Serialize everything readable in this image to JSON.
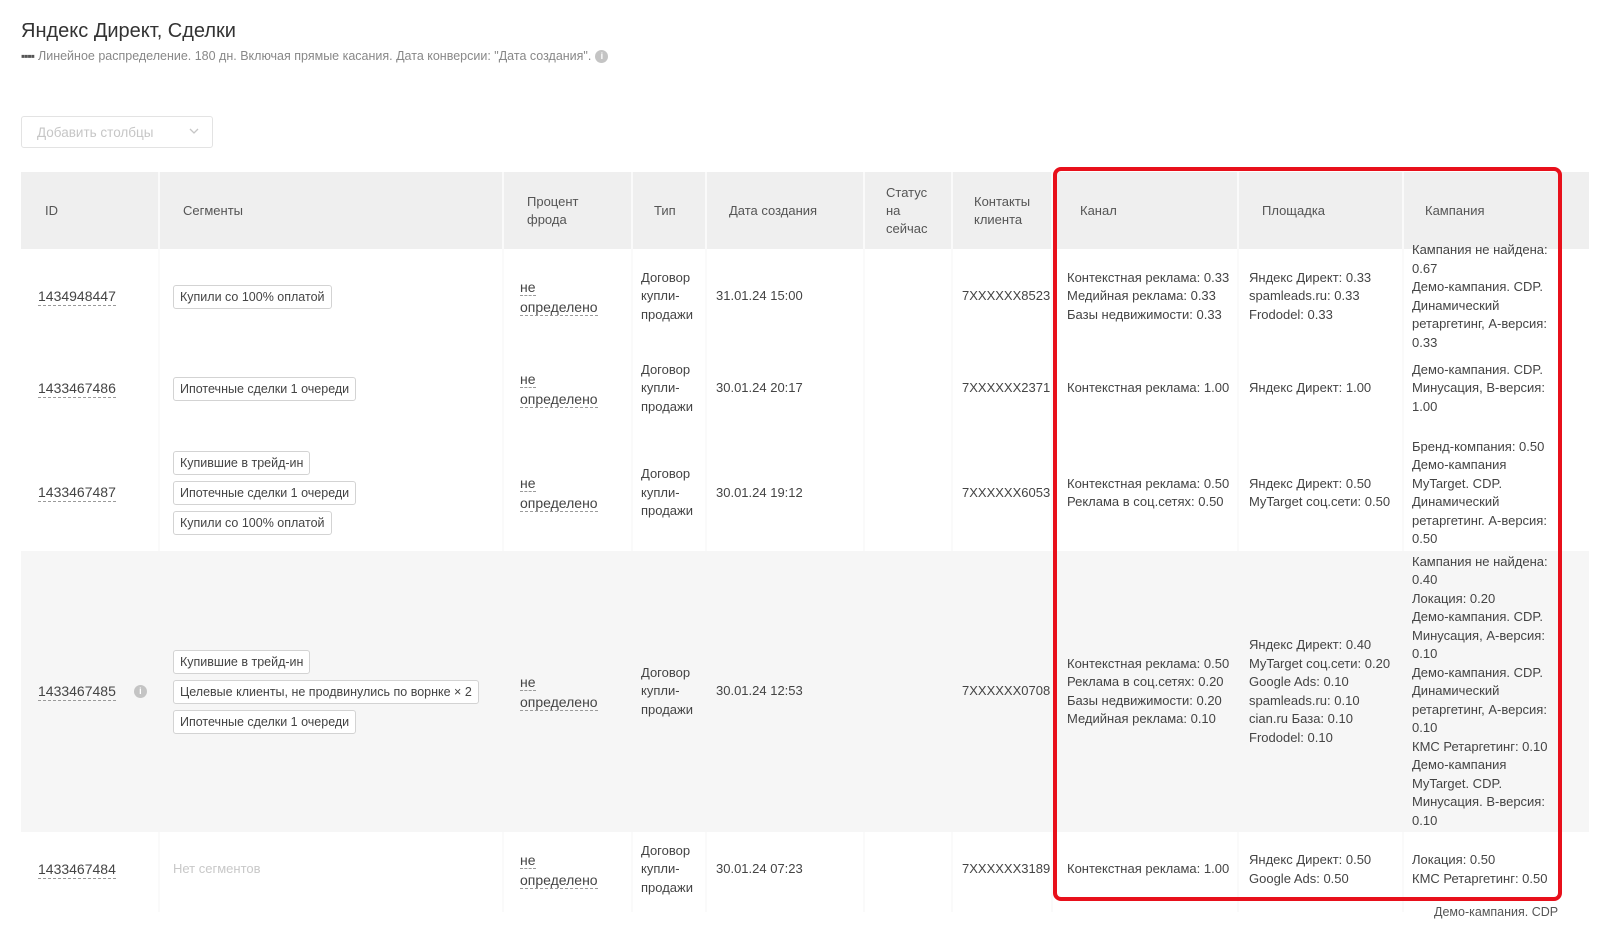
{
  "header": {
    "title": "Яндекс Директ, Сделки",
    "subtitle": "Линейное распределение. 180 дн. Включая прямые касания. Дата конверсии: \"Дата создания\".",
    "dots": "▪▪▪▪"
  },
  "toolbar": {
    "add_columns_placeholder": "Добавить столбцы"
  },
  "columns": {
    "id": "ID",
    "segments": "Сегменты",
    "fraud": "Процент фрода",
    "type": "Тип",
    "created": "Дата создания",
    "status": "Статус на сейчас",
    "contacts": "Контакты клиента",
    "channel": "Канал",
    "platform": "Площадка",
    "campaign": "Кампания"
  },
  "rows": [
    {
      "id": "1434948447",
      "segments": [
        "Купили со 100% оплатой"
      ],
      "fraud": "не определено",
      "type": "Договор купли-продажи",
      "created": "31.01.24 15:00",
      "status": "",
      "contact": "7XXXXXX8523",
      "channel": [
        "Контекстная реклама: 0.33",
        "Медийная реклама: 0.33",
        "Базы недвижимости: 0.33"
      ],
      "platform": [
        "Яндекс Директ: 0.33",
        "spamleads.ru: 0.33",
        "Frododel: 0.33"
      ],
      "campaign": [
        "Кампания не найдена: 0.67",
        "Демо-кампания. CDP. Динамический ретаргетинг, А-версия: 0.33"
      ]
    },
    {
      "id": "1433467486",
      "segments": [
        "Ипотечные сделки 1 очереди"
      ],
      "fraud": "не определено",
      "type": "Договор купли-продажи",
      "created": "30.01.24 20:17",
      "status": "",
      "contact": "7XXXXXX2371",
      "channel": [
        "Контекстная реклама: 1.00"
      ],
      "platform": [
        "Яндекс Директ: 1.00"
      ],
      "campaign": [
        "Демо-кампания. CDP. Минусация, В-версия: 1.00"
      ]
    },
    {
      "id": "1433467487",
      "segments": [
        "Купившие в трейд-ин",
        "Ипотечные сделки 1 очереди",
        "Купили со 100% оплатой"
      ],
      "fraud": "не определено",
      "type": "Договор купли-продажи",
      "created": "30.01.24 19:12",
      "status": "",
      "contact": "7XXXXXX6053",
      "channel": [
        "Контекстная реклама: 0.50",
        "Реклама в соц.сетях: 0.50"
      ],
      "platform": [
        "Яндекс Директ: 0.50",
        "MyTarget соц.сети: 0.50"
      ],
      "campaign": [
        "Бренд-компания: 0.50",
        "Демо-кампания MyTarget. CDP. Динамический ретаргетинг. А-версия: 0.50"
      ]
    },
    {
      "id": "1433467485",
      "segments": [
        "Купившие в трейд-ин",
        "Целевые клиенты, не продвинулись по ворнке × 2",
        "Ипотечные сделки 1 очереди"
      ],
      "fraud": "не определено",
      "type": "Договор купли-продажи",
      "created": "30.01.24 12:53",
      "status": "",
      "contact": "7XXXXXX0708",
      "channel": [
        "Контекстная реклама: 0.50",
        "Реклама в соц.сетях: 0.20",
        "Базы недвижимости: 0.20",
        "Медийная реклама: 0.10"
      ],
      "platform": [
        "Яндекс Директ: 0.40",
        "MyTarget соц.сети: 0.20",
        "Google Ads: 0.10",
        "spamleads.ru: 0.10",
        "cian.ru База: 0.10",
        "Frododel: 0.10"
      ],
      "campaign": [
        "Кампания не найдена: 0.40",
        "Локация: 0.20",
        "Демо-кампания. CDP. Минусация, А-версия: 0.10",
        "Демо-кампания. CDP. Динамический ретаргетинг, А-версия: 0.10",
        "КМС Ретаргетинг: 0.10",
        "Демо-кампания MyTarget. CDP. Минусация. В-версия: 0.10"
      ]
    },
    {
      "id": "1433467484",
      "segments": [],
      "no_segments": "Нет сегментов",
      "fraud": "не определено",
      "type": "Договор купли-продажи",
      "created": "30.01.24 07:23",
      "status": "",
      "contact": "7XXXXXX3189",
      "channel": [
        "Контекстная реклама: 1.00"
      ],
      "platform": [
        "Яндекс Директ: 0.50",
        "Google Ads: 0.50"
      ],
      "campaign": [
        "Локация: 0.50",
        "КМС Ретаргетинг: 0.50"
      ]
    }
  ],
  "cutoff_text": "Демо-кампания. CDP",
  "colors": {
    "highlight": "#e8101b",
    "header_bg": "#efefef",
    "alt_row_bg": "#f6f6f6"
  }
}
